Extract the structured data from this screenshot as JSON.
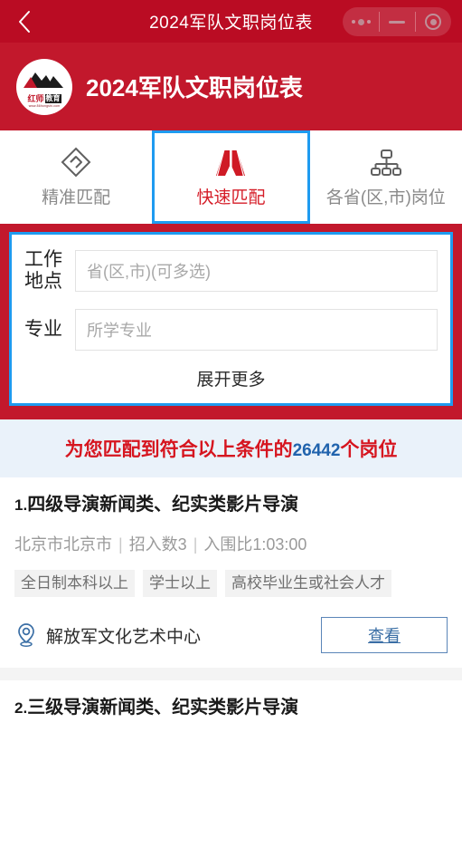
{
  "window": {
    "title": "2024军队文职岗位表",
    "back_icon": "chevron-left-icon",
    "capsule": {
      "more_icon": "more-dots-icon",
      "minimize_icon": "minimize-icon",
      "close_icon": "target-circle-icon"
    }
  },
  "brand": {
    "title": "2024军队文职岗位表",
    "logo_text_red": "红师",
    "logo_text_black": "教育",
    "logo_url": "www.86hongshi.com",
    "logo_icon": "mountain-logo-icon",
    "bg_color": "#c2182c"
  },
  "tabs": [
    {
      "label": "精准匹配",
      "icon": "diamond-match-icon",
      "active": false
    },
    {
      "label": "快速匹配",
      "icon": "road-icon",
      "active": true
    },
    {
      "label": "各省(区,市)岗位",
      "icon": "org-chart-icon",
      "active": false
    }
  ],
  "search": {
    "fields": [
      {
        "label": "工作地点",
        "placeholder": "省(区,市)(可多选)",
        "value": ""
      },
      {
        "label": "专业",
        "placeholder": "所学专业",
        "value": ""
      }
    ],
    "expand_label": "展开更多",
    "border_color": "#1e9bf0"
  },
  "result_banner": {
    "prefix": "为您匹配到符合以上条件的",
    "count": "26442",
    "suffix": "个岗位",
    "count_color": "#2063ad",
    "text_color": "#d6151f",
    "bg_color": "#eaf2fa"
  },
  "jobs": [
    {
      "index": "1.",
      "title": "四级导演新闻类、纪实类影片导演",
      "location": "北京市北京市",
      "hires": "招入数3",
      "ratio": "入围比1:03:00",
      "separator": "|",
      "tags": [
        "全日制本科以上",
        "学士以上",
        "高校毕业生或社会人才"
      ],
      "org": "解放军文化艺术中心",
      "org_icon": "location-pin-icon",
      "view_label": "查看"
    },
    {
      "index": "2.",
      "title": "三级导演新闻类、纪实类影片导演"
    }
  ]
}
